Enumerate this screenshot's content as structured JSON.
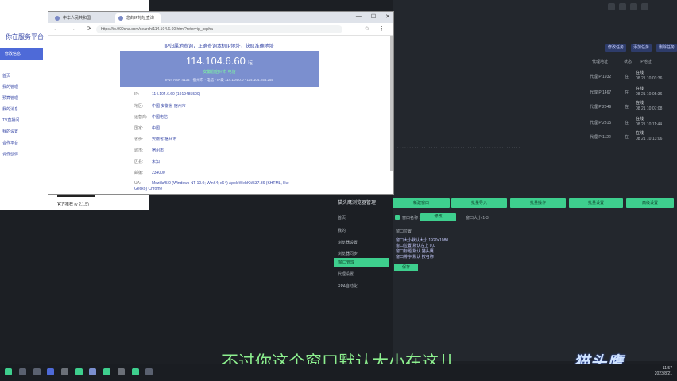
{
  "left_window": {
    "title": "你在服务平台",
    "button": "修改信息",
    "items": [
      "首页",
      "我的管理",
      "预算管理",
      "我的消息",
      "TV直播间",
      "我的设置",
      "合作平台",
      "合作伙伴"
    ],
    "footer": "官方推荐 (v 2.1.5)"
  },
  "browser": {
    "tabs": [
      {
        "label": "中华人民共和国",
        "active": false
      },
      {
        "label": "您的IP地址查询",
        "active": true
      }
    ],
    "window_controls": [
      "—",
      "☐",
      "✕"
    ],
    "nav_glyphs": "← → ⟳",
    "url": "https://ip.900cha.com/search/114.104.6.60.html?refer=ip_xqcha",
    "tool_glyphs": "☆ ⋮",
    "notice": "IP归属地查询，正确查询本机IP地址，获取准确地址",
    "ip": "114.104.6.60",
    "ip_copy": "⎘",
    "location": "安徽省宿州市 电信",
    "extra": "IPv4 ASN 4134 · 宿州市 · 电信 · IP段 114.104.0.0 - 114.104.255.255",
    "info_rows": [
      {
        "k": "IP:",
        "v": "114.104.6.60 (1919485500)"
      },
      {
        "k": "地区:",
        "v": "中国 安徽省 宿州市"
      },
      {
        "k": "运营商:",
        "v": "中国电信"
      },
      {
        "k": "国家:",
        "v": "中国"
      },
      {
        "k": "省份:",
        "v": "安徽省 宿州市"
      },
      {
        "k": "城市:",
        "v": "宿州市"
      },
      {
        "k": "区县:",
        "v": "未知"
      },
      {
        "k": "邮编:",
        "v": "234000"
      },
      {
        "k": "UA:",
        "v": "Mozilla/5.0 (Windows NT 10.0; Win64; x64) AppleWebKit/537.36 (KHTML, like Gecko) Chrome"
      }
    ]
  },
  "dark_app": {
    "buttons": [
      "修改任务",
      "添加任务",
      "删除任务"
    ],
    "headers": [
      "代理地址",
      "状态",
      "IP地址"
    ],
    "rows": [
      {
        "a": "代理IP 1932",
        "b": "在",
        "c": "在线",
        "d": "08 21 10:03:36"
      },
      {
        "a": "代理IP 1467",
        "b": "在",
        "c": "在线",
        "d": "08 21 10:05:36"
      },
      {
        "a": "代理IP 2049",
        "b": "在",
        "c": "在线",
        "d": "08 21 10:07:08"
      },
      {
        "a": "代理IP 2315",
        "b": "在",
        "c": "在线",
        "d": "08 21 10:11:44"
      },
      {
        "a": "代理IP 1122",
        "b": "在",
        "c": "在线",
        "d": "08 21 10:13:06"
      }
    ],
    "panel_title": "猫头鹰浏览器管理",
    "green_tabs": [
      "新建窗口",
      "批量导入",
      "批量操作",
      "批量设置",
      "高级设置"
    ],
    "side_items": [
      "首页",
      "我的",
      "浏览器设置",
      "浏览器同步",
      "窗口管理",
      "代理设置",
      "RPA自动化"
    ],
    "active_side": "窗口管理",
    "panel_rows": [
      "窗口名称 1-5",
      "修改",
      "窗口大小 1-3",
      "窗口位置"
    ],
    "lines": [
      "窗口大小默认大小 1920x1080",
      "窗口位置 默认左上 0,0",
      "窗口标题 默认 猫头鹰",
      "窗口排序 默认 按名称"
    ],
    "save_button": "保存"
  },
  "subtitle": "不过你这个窗口默认大小在这儿",
  "logo": "猫头鹰",
  "clock": [
    "11:57",
    "2023/8/21"
  ],
  "colors": {
    "accent_green": "#3ecf8e",
    "ip_box": "#7b8fcf",
    "subtitle": "#8df08f"
  }
}
